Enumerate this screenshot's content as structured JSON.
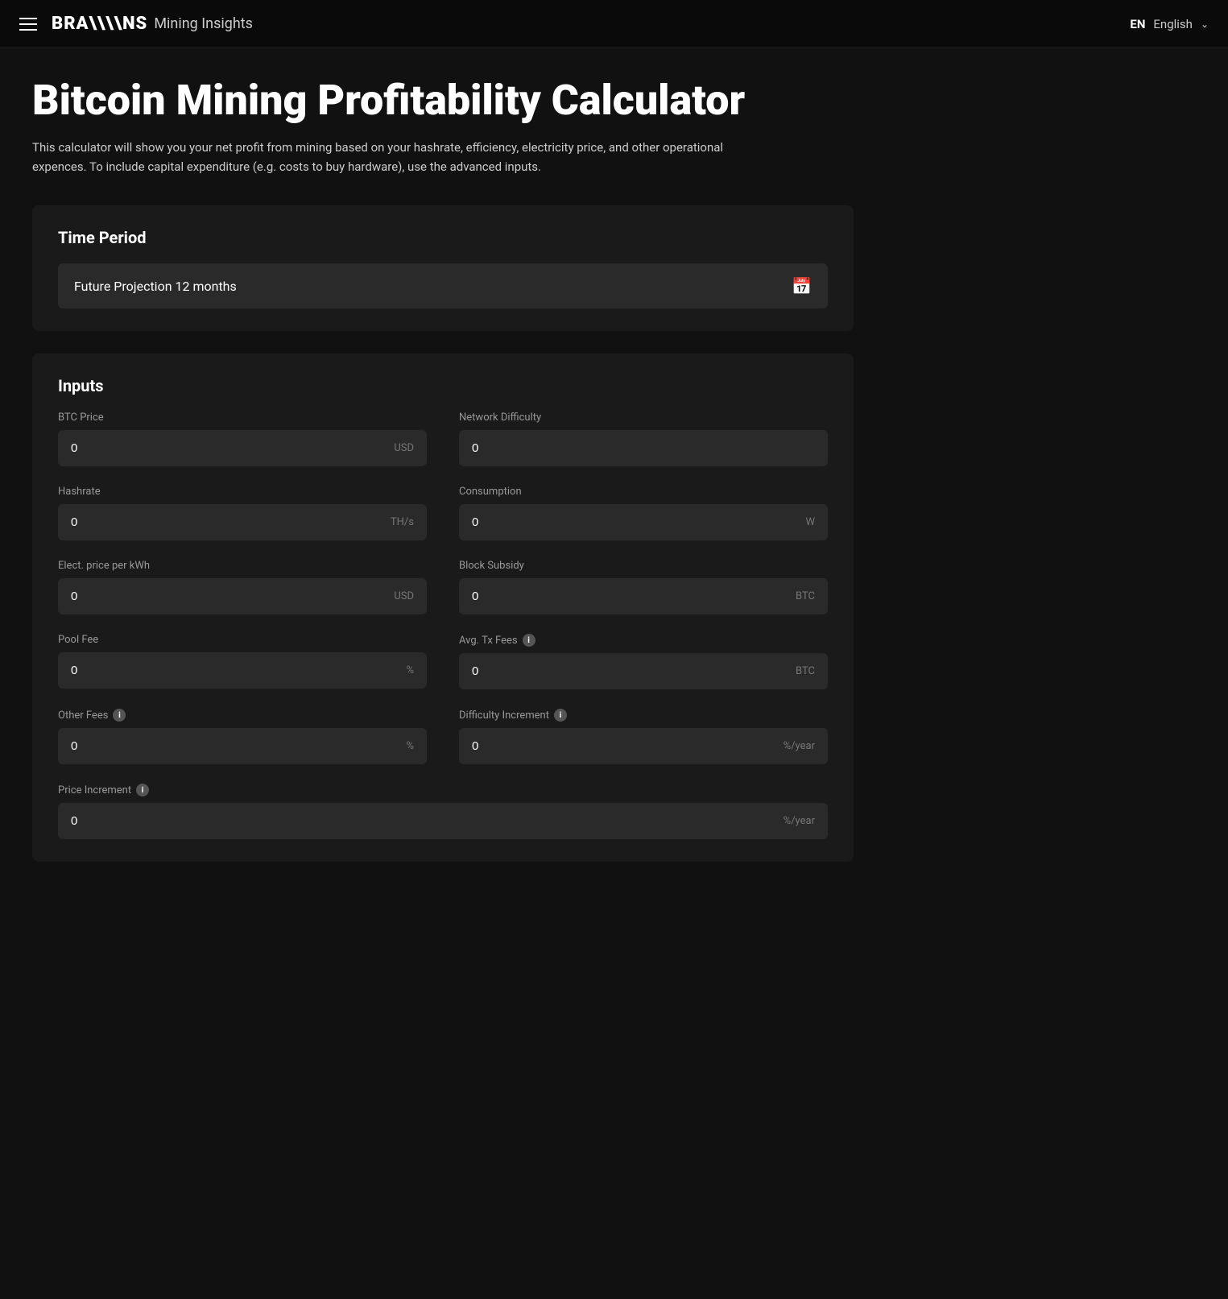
{
  "navbar": {
    "brand_logo": "BRA\\\\NS",
    "brand_title": "Mining Insights",
    "lang_code": "EN",
    "lang_text": "English"
  },
  "page": {
    "title": "Bitcoin Mining Profitability Calculator",
    "description": "This calculator will show you your net profit from mining based on your hashrate, efficiency, electricity price, and other operational expences. To include capital expenditure (e.g. costs to buy hardware), use the advanced inputs."
  },
  "time_period": {
    "section_title": "Time Period",
    "selected_label": "Future Projection 12 months"
  },
  "inputs": {
    "section_title": "Inputs",
    "fields": [
      {
        "label": "BTC Price",
        "value": "0",
        "unit": "USD",
        "has_info": false,
        "id": "btc-price"
      },
      {
        "label": "Network Difficulty",
        "value": "0",
        "unit": "",
        "has_info": false,
        "id": "network-difficulty"
      },
      {
        "label": "Hashrate",
        "value": "0",
        "unit": "TH/s",
        "has_info": false,
        "id": "hashrate"
      },
      {
        "label": "Consumption",
        "value": "0",
        "unit": "W",
        "has_info": false,
        "id": "consumption"
      },
      {
        "label": "Elect. price per kWh",
        "value": "0",
        "unit": "USD",
        "has_info": false,
        "id": "electricity-price"
      },
      {
        "label": "Block Subsidy",
        "value": "0",
        "unit": "BTC",
        "has_info": false,
        "id": "block-subsidy"
      },
      {
        "label": "Pool Fee",
        "value": "0",
        "unit": "%",
        "has_info": false,
        "id": "pool-fee"
      },
      {
        "label": "Avg. Tx Fees",
        "value": "0",
        "unit": "BTC",
        "has_info": true,
        "id": "avg-tx-fees"
      },
      {
        "label": "Other Fees",
        "value": "0",
        "unit": "%",
        "has_info": true,
        "id": "other-fees"
      },
      {
        "label": "Difficulty Increment",
        "value": "0",
        "unit": "%/year",
        "has_info": true,
        "id": "difficulty-increment"
      },
      {
        "label": "Price Increment",
        "value": "0",
        "unit": "%/year",
        "has_info": true,
        "id": "price-increment",
        "full_width": true
      }
    ]
  }
}
